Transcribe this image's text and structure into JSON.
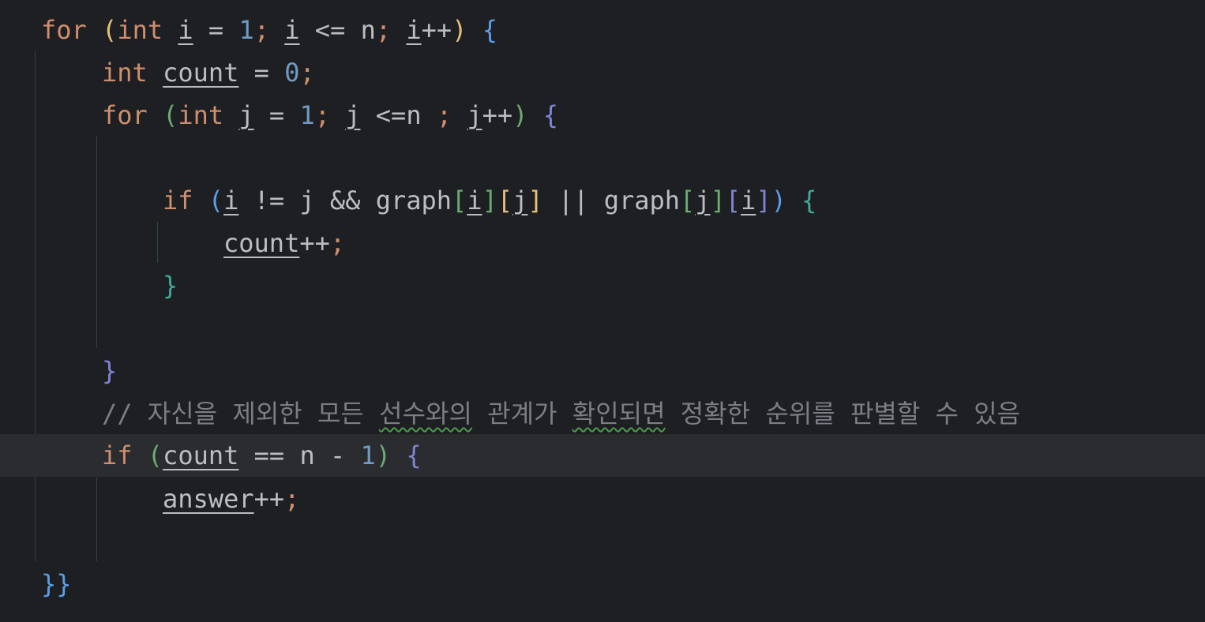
{
  "editor": {
    "lines": [
      {
        "tokens": [
          {
            "t": "for",
            "c": "kw"
          },
          {
            "t": " ",
            "c": "op"
          },
          {
            "t": "(",
            "c": "p1"
          },
          {
            "t": "int",
            "c": "kw"
          },
          {
            "t": " ",
            "c": "op"
          },
          {
            "t": "i",
            "c": "var"
          },
          {
            "t": " = ",
            "c": "op"
          },
          {
            "t": "1",
            "c": "num"
          },
          {
            "t": ";",
            "c": "semi"
          },
          {
            "t": " ",
            "c": "op"
          },
          {
            "t": "i",
            "c": "var"
          },
          {
            "t": " <= n",
            "c": "op"
          },
          {
            "t": ";",
            "c": "semi"
          },
          {
            "t": " ",
            "c": "op"
          },
          {
            "t": "i",
            "c": "var"
          },
          {
            "t": "++",
            "c": "op"
          },
          {
            "t": ")",
            "c": "p1"
          },
          {
            "t": " ",
            "c": "op"
          },
          {
            "t": "{",
            "c": "p2"
          }
        ]
      },
      {
        "tokens": [
          {
            "t": "int",
            "c": "kw"
          },
          {
            "t": " ",
            "c": "op"
          },
          {
            "t": "count",
            "c": "var"
          },
          {
            "t": " = ",
            "c": "op"
          },
          {
            "t": "0",
            "c": "num"
          },
          {
            "t": ";",
            "c": "semi"
          }
        ]
      },
      {
        "tokens": [
          {
            "t": "for",
            "c": "kw"
          },
          {
            "t": " ",
            "c": "op"
          },
          {
            "t": "(",
            "c": "p3"
          },
          {
            "t": "int",
            "c": "kw"
          },
          {
            "t": " ",
            "c": "op"
          },
          {
            "t": "j",
            "c": "var"
          },
          {
            "t": " = ",
            "c": "op"
          },
          {
            "t": "1",
            "c": "num"
          },
          {
            "t": ";",
            "c": "semi"
          },
          {
            "t": " ",
            "c": "op"
          },
          {
            "t": "j",
            "c": "var"
          },
          {
            "t": " <=n ",
            "c": "op"
          },
          {
            "t": ";",
            "c": "semi"
          },
          {
            "t": " ",
            "c": "op"
          },
          {
            "t": "j",
            "c": "var"
          },
          {
            "t": "++",
            "c": "op"
          },
          {
            "t": ")",
            "c": "p3"
          },
          {
            "t": " ",
            "c": "op"
          },
          {
            "t": "{",
            "c": "p4"
          }
        ]
      },
      {
        "tokens": []
      },
      {
        "tokens": [
          {
            "t": "if",
            "c": "kw"
          },
          {
            "t": " ",
            "c": "op"
          },
          {
            "t": "(",
            "c": "p2"
          },
          {
            "t": "i",
            "c": "var"
          },
          {
            "t": " != j && graph",
            "c": "op"
          },
          {
            "t": "[",
            "c": "p3"
          },
          {
            "t": "i",
            "c": "var"
          },
          {
            "t": "]",
            "c": "p3"
          },
          {
            "t": "[",
            "c": "p1"
          },
          {
            "t": "j",
            "c": "var"
          },
          {
            "t": "]",
            "c": "p1"
          },
          {
            "t": " || graph",
            "c": "op"
          },
          {
            "t": "[",
            "c": "p3"
          },
          {
            "t": "j",
            "c": "var"
          },
          {
            "t": "]",
            "c": "p3"
          },
          {
            "t": "[",
            "c": "p4"
          },
          {
            "t": "i",
            "c": "var"
          },
          {
            "t": "]",
            "c": "p4"
          },
          {
            "t": ")",
            "c": "p2"
          },
          {
            "t": " ",
            "c": "op"
          },
          {
            "t": "{",
            "c": "p5"
          }
        ]
      },
      {
        "tokens": [
          {
            "t": "count",
            "c": "var"
          },
          {
            "t": "++",
            "c": "op"
          },
          {
            "t": ";",
            "c": "semi"
          }
        ]
      },
      {
        "tokens": [
          {
            "t": "}",
            "c": "p5"
          }
        ]
      },
      {
        "tokens": []
      },
      {
        "tokens": [
          {
            "t": "}",
            "c": "p4"
          }
        ]
      },
      {
        "tokens": [
          {
            "t": "// 자신을 제외한 모든 ",
            "c": "cmt"
          },
          {
            "t": "선수와의",
            "c": "cmt typo"
          },
          {
            "t": " 관계가 ",
            "c": "cmt"
          },
          {
            "t": "확인되면",
            "c": "cmt typo"
          },
          {
            "t": " 정확한 순위를 판별할 수 있음",
            "c": "cmt"
          }
        ]
      },
      {
        "tokens": [
          {
            "t": "if",
            "c": "kw"
          },
          {
            "t": " ",
            "c": "op"
          },
          {
            "t": "(",
            "c": "p3"
          },
          {
            "t": "count",
            "c": "var"
          },
          {
            "t": " == n - ",
            "c": "op"
          },
          {
            "t": "1",
            "c": "num"
          },
          {
            "t": ")",
            "c": "p3"
          },
          {
            "t": " ",
            "c": "op"
          },
          {
            "t": "{",
            "c": "p4"
          }
        ]
      },
      {
        "tokens": [
          {
            "t": "answer",
            "c": "var"
          },
          {
            "t": "++",
            "c": "op"
          },
          {
            "t": ";",
            "c": "semi"
          }
        ]
      },
      {
        "tokens": []
      },
      {
        "tokens": [
          {
            "t": "}}",
            "c": "p2"
          }
        ]
      }
    ]
  }
}
